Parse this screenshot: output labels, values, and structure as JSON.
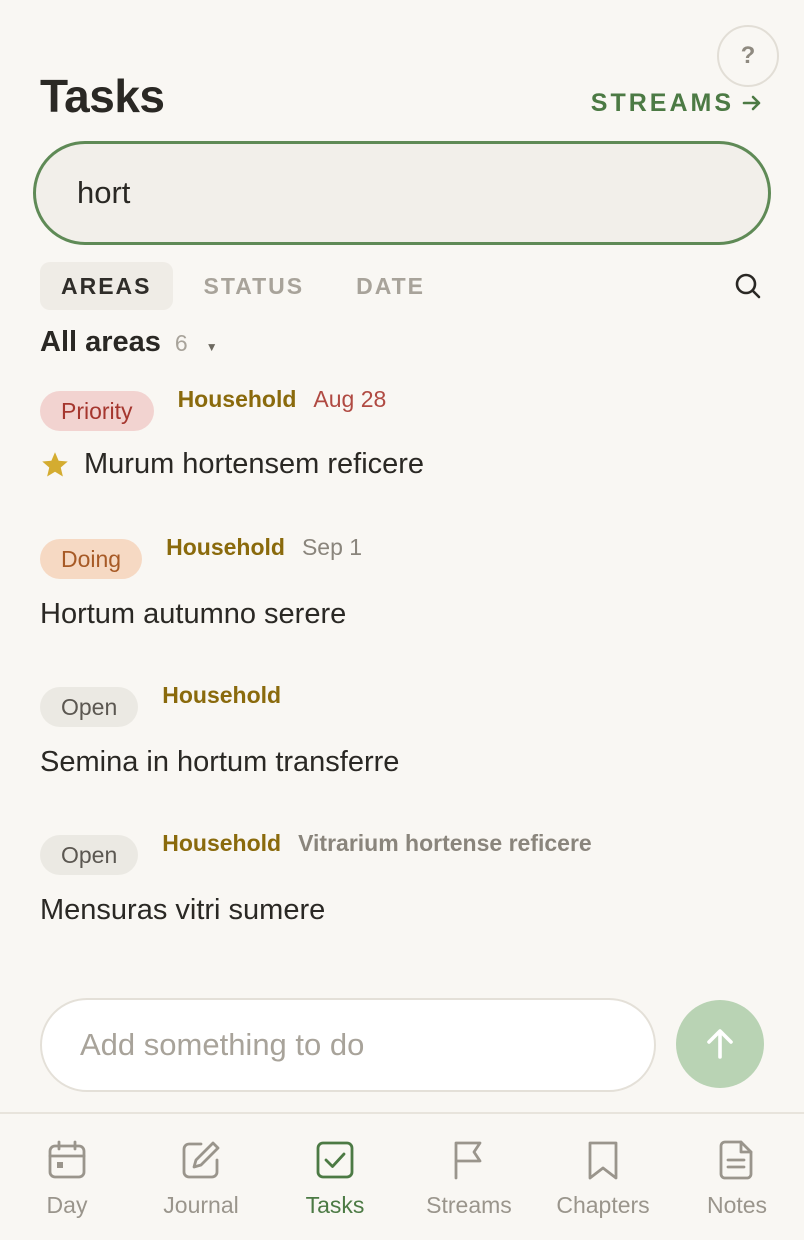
{
  "header": {
    "title": "Tasks",
    "help_label": "?",
    "streams_link": "STREAMS"
  },
  "search": {
    "value": "hort"
  },
  "filters": {
    "tabs": [
      {
        "label": "AREAS",
        "active": true
      },
      {
        "label": "STATUS",
        "active": false
      },
      {
        "label": "DATE",
        "active": false
      }
    ]
  },
  "areas": {
    "label": "All areas",
    "count": "6"
  },
  "tasks": [
    {
      "status": "Priority",
      "area": "Household",
      "date": "Aug 28",
      "title": "Murum hortensem reficere",
      "starred": true
    },
    {
      "status": "Doing",
      "area": "Household",
      "date": "Sep 1",
      "title": "Hortum autumno serere"
    },
    {
      "status": "Open",
      "area": "Household",
      "title": "Semina in hortum transferre"
    },
    {
      "status": "Open",
      "area": "Household",
      "parent": "Vitrarium hortense reficere",
      "title": "Mensuras vitri sumere"
    }
  ],
  "composer": {
    "placeholder": "Add something to do"
  },
  "tab_bar": {
    "items": [
      {
        "label": "Day",
        "icon": "calendar-icon"
      },
      {
        "label": "Journal",
        "icon": "edit-icon"
      },
      {
        "label": "Tasks",
        "icon": "checkbox-icon",
        "active": true
      },
      {
        "label": "Streams",
        "icon": "flag-icon"
      },
      {
        "label": "Chapters",
        "icon": "bookmark-icon"
      },
      {
        "label": "Notes",
        "icon": "document-icon"
      }
    ]
  },
  "colors": {
    "accent": "#4c7a44",
    "priority": "#a5362e",
    "doing": "#a75a26",
    "area": "#8a6a0c",
    "send_button": "#b9d3b4"
  }
}
